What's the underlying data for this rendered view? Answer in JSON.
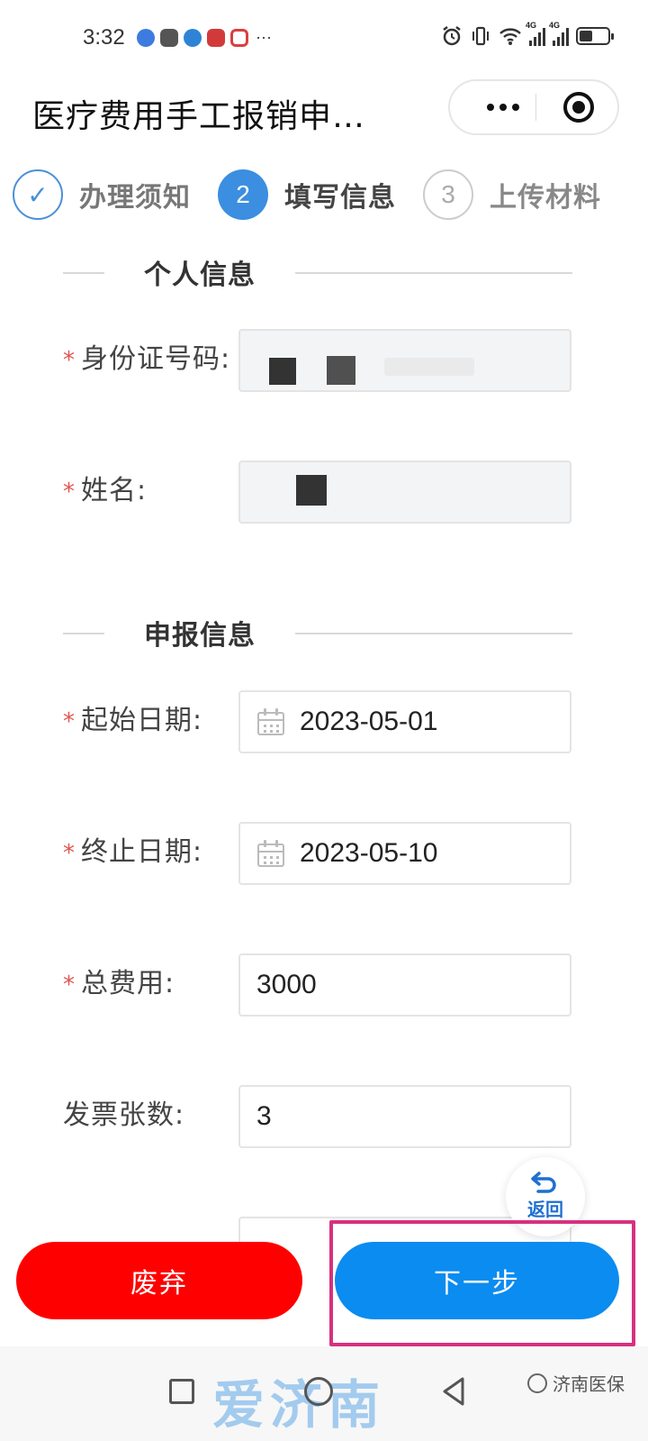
{
  "status_bar": {
    "time": "3:32",
    "more_indicator": "···",
    "network_left": "4G",
    "network_right": "4G",
    "battery_level": 0.45
  },
  "header": {
    "title": "医疗费用手工报销申…"
  },
  "stepper": {
    "steps": [
      {
        "number": "✓",
        "label": "办理须知",
        "state": "done"
      },
      {
        "number": "2",
        "label": "填写信息",
        "state": "active"
      },
      {
        "number": "3",
        "label": "上传材料",
        "state": "todo"
      }
    ]
  },
  "sections": {
    "personal": "个人信息",
    "declaration": "申报信息"
  },
  "form": {
    "id_number": {
      "label": "身份证号码:",
      "required": "*"
    },
    "name": {
      "label": "姓名:",
      "required": "*"
    },
    "start_date": {
      "label": "起始日期:",
      "required": "*",
      "value": "2023-05-01"
    },
    "end_date": {
      "label": "终止日期:",
      "required": "*",
      "value": "2023-05-10"
    },
    "total_cost": {
      "label": "总费用:",
      "required": "*",
      "value": "3000"
    },
    "invoice_count": {
      "label": "发票张数:",
      "value": "3"
    }
  },
  "float_back": {
    "label": "返回"
  },
  "buttons": {
    "abandon": "废弃",
    "next": "下一步"
  },
  "watermark": {
    "logo": "爱济南",
    "badge": "济南医保"
  },
  "colors": {
    "primary": "#3b8ee0",
    "next_button": "#0b8cf0",
    "abandon_button": "#ff0000",
    "required": "#e15550",
    "highlight": "#d6317f"
  }
}
